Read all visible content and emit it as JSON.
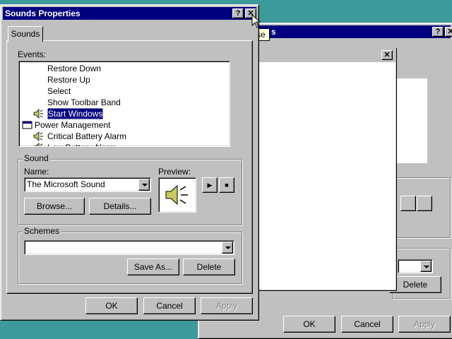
{
  "bg_window": {
    "title_fragment": "s",
    "tooltip_fragment": "se",
    "ok_label": "OK",
    "cancel_label": "Cancel",
    "apply_label": "Apply",
    "delete_label": "Delete",
    "help_glyph": "?",
    "close_glyph": "✕"
  },
  "dialog": {
    "title": "Sounds Properties",
    "help_glyph": "?",
    "close_glyph": "✕",
    "tab_label": "Sounds",
    "events_label": "Events:",
    "events": [
      {
        "label": "Restore Down",
        "indent": 2,
        "icon": "none",
        "selected": false
      },
      {
        "label": "Restore Up",
        "indent": 2,
        "icon": "none",
        "selected": false
      },
      {
        "label": "Select",
        "indent": 2,
        "icon": "none",
        "selected": false
      },
      {
        "label": "Show Toolbar Band",
        "indent": 2,
        "icon": "none",
        "selected": false
      },
      {
        "label": "Start Windows",
        "indent": 2,
        "icon": "speaker-icon",
        "selected": true
      },
      {
        "label": "Power Management",
        "indent": 1,
        "icon": "window-icon",
        "selected": false
      },
      {
        "label": "Critical Battery Alarm",
        "indent": 2,
        "icon": "speaker-icon",
        "selected": false
      },
      {
        "label": "Low Battery Alarm",
        "indent": 2,
        "icon": "speaker-icon",
        "selected": false
      }
    ],
    "sound_group_label": "Sound",
    "name_label": "Name:",
    "name_value": "The Microsoft Sound",
    "preview_label": "Preview:",
    "play_glyph": "▶",
    "stop_glyph": "■",
    "browse_label": "Browse...",
    "details_label": "Details...",
    "schemes_group_label": "Schemes",
    "schemes_value": "",
    "save_as_label": "Save As...",
    "delete_label": "Delete",
    "ok_label": "OK",
    "cancel_label": "Cancel",
    "apply_label": "Apply"
  },
  "inner_window": {
    "close_glyph": "✕"
  },
  "colors": {
    "desktop": "#3d9a9a",
    "titlebar": "#000080",
    "selection": "#000080",
    "face": "#c0c0c0"
  }
}
